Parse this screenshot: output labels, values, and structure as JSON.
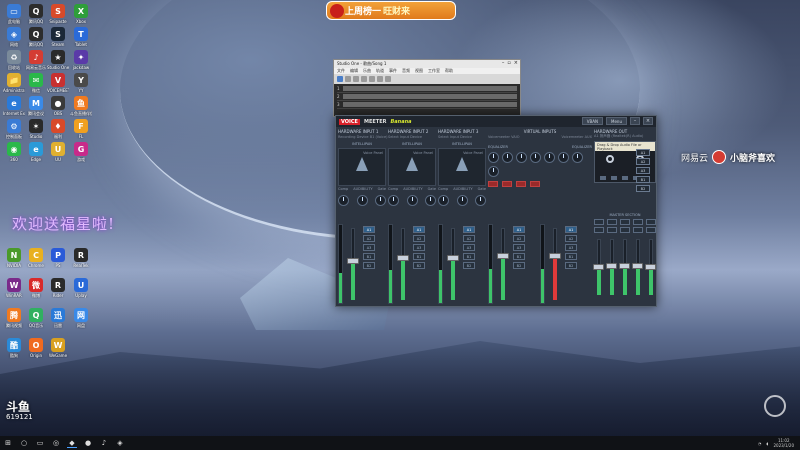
{
  "banner": {
    "part1": "上周榜一",
    "part2": "旺财来"
  },
  "desktop_icons": [
    {
      "label": "此电脑",
      "color": "#3a7bd5",
      "glyph": "▭"
    },
    {
      "label": "腾讯QQ",
      "color": "#2c2c2c",
      "glyph": "Q"
    },
    {
      "label": "Snipaste",
      "color": "#d84a2a",
      "glyph": "S"
    },
    {
      "label": "Xbox",
      "color": "#2e9e3a",
      "glyph": "X"
    },
    {
      "label": "网络",
      "color": "#3a7bd5",
      "glyph": "◈"
    },
    {
      "label": "腾讯QQ",
      "color": "#2c2c2c",
      "glyph": "Q"
    },
    {
      "label": "Steam",
      "color": "#1b2838",
      "glyph": "S"
    },
    {
      "label": "Tablet",
      "color": "#2a6ad8",
      "glyph": "T"
    },
    {
      "label": "回收站",
      "color": "#7a8a9a",
      "glyph": "♻"
    },
    {
      "label": "网易云音乐",
      "color": "#d43c33",
      "glyph": "♪"
    },
    {
      "label": "Studio One",
      "color": "#2a2a2a",
      "glyph": "★"
    },
    {
      "label": "jackdaw",
      "color": "#5a3aa8",
      "glyph": "✦"
    },
    {
      "label": "Administrator",
      "color": "#e0b030",
      "glyph": "📁"
    },
    {
      "label": "微信",
      "color": "#2ab84a",
      "glyph": "✉"
    },
    {
      "label": "VOICEMEETER",
      "color": "#c83030",
      "glyph": "V"
    },
    {
      "label": "YY",
      "color": "#4a4a4a",
      "glyph": "Y"
    },
    {
      "label": "Internet Explorer",
      "color": "#2a7ad8",
      "glyph": "e"
    },
    {
      "label": "腾讯会议",
      "color": "#3a8ae8",
      "glyph": "M"
    },
    {
      "label": "OBS",
      "color": "#3a3a3a",
      "glyph": "●"
    },
    {
      "label": "斗鱼直播伴侣",
      "color": "#f07a20",
      "glyph": "鱼"
    },
    {
      "label": "控制面板",
      "color": "#3a7bd5",
      "glyph": "⚙"
    },
    {
      "label": "Studio",
      "color": "#2a2a2a",
      "glyph": "✶"
    },
    {
      "label": "福利",
      "color": "#d84a2a",
      "glyph": "♦"
    },
    {
      "label": "FL",
      "color": "#f0a020",
      "glyph": "F"
    },
    {
      "label": "360",
      "color": "#2ab84a",
      "glyph": "◉"
    },
    {
      "label": "Edge",
      "color": "#2a9ad8",
      "glyph": "e"
    },
    {
      "label": "UU",
      "color": "#e0b030",
      "glyph": "U"
    },
    {
      "label": "游戏",
      "color": "#c82a8a",
      "glyph": "G"
    }
  ],
  "daw": {
    "title": "Studio One - 歌曲/Song 1",
    "menus": [
      "文件",
      "编辑",
      "乐曲",
      "轨道",
      "事件",
      "音频",
      "视图",
      "工作室",
      "帮助"
    ],
    "tracks": [
      "1",
      "2",
      "3"
    ]
  },
  "voicemeeter": {
    "logo_a": "VOICE",
    "logo_b": "MEETER",
    "logo_c": "Banana",
    "vban_label": "VBAN",
    "menu_label": "Menu",
    "hw_inputs": [
      {
        "name": "HARDWARE INPUT 1",
        "sub": "Recording Device B1 (Voice)",
        "mode": "INTELLIPAN",
        "panel": "Voice Panel",
        "knob_labels": [
          "Comp",
          "AUDIBILITY",
          "Gate"
        ]
      },
      {
        "name": "HARDWARE INPUT 2",
        "sub": "Select Input Device",
        "mode": "INTELLIPAN",
        "panel": "Voice Panel",
        "knob_labels": [
          "Comp",
          "AUDIBILITY",
          "Gate"
        ]
      },
      {
        "name": "HARDWARE INPUT 3",
        "sub": "Select Input Device",
        "mode": "INTELLIPAN",
        "panel": "Voice Panel",
        "knob_labels": [
          "Comp",
          "AUDIBILITY",
          "Gate"
        ]
      }
    ],
    "virtual_inputs": [
      {
        "name": "VIRTUAL INPUTS",
        "sub1": "Voicemeeter VAIO",
        "sub2": "Voicemeeter AUX",
        "eq1": "EQUALIZER",
        "eq2": "EQUALIZER"
      }
    ],
    "hw_out": {
      "name": "HARDWARE OUT",
      "sub": "A1 扬声器 (Realtek(R) Audio)",
      "cassette_label": "Drag & Drop Audio File or Playback",
      "master_title": "MASTER SECTION"
    },
    "bus_buttons": [
      "A1",
      "A2",
      "A3",
      "B1",
      "B2"
    ],
    "ab_buttons": [
      "A1",
      "A2",
      "A3",
      "B1",
      "B2"
    ],
    "strip_levels": [
      0.55,
      0.6,
      0.6,
      0.62,
      0.62
    ],
    "strip_colors": [
      "#3ec46a",
      "#3ec46a",
      "#3ec46a",
      "#3ec46a",
      "#e03a3a"
    ],
    "bus_levels": [
      0.58,
      0.6,
      0.6,
      0.6,
      0.58
    ]
  },
  "netease": {
    "text1": "网易云",
    "text2": "小脑斧喜欢"
  },
  "deco_text": "欢迎送福星啦!",
  "bottom_mark": {
    "main": "斗鱼",
    "sub": "619121"
  },
  "taskbar": {
    "items": [
      "⊞",
      "○",
      "▭",
      "◎",
      "◆",
      "●",
      "♪",
      "◈"
    ],
    "clock_time": "11:02",
    "clock_date": "2023/1/20"
  }
}
